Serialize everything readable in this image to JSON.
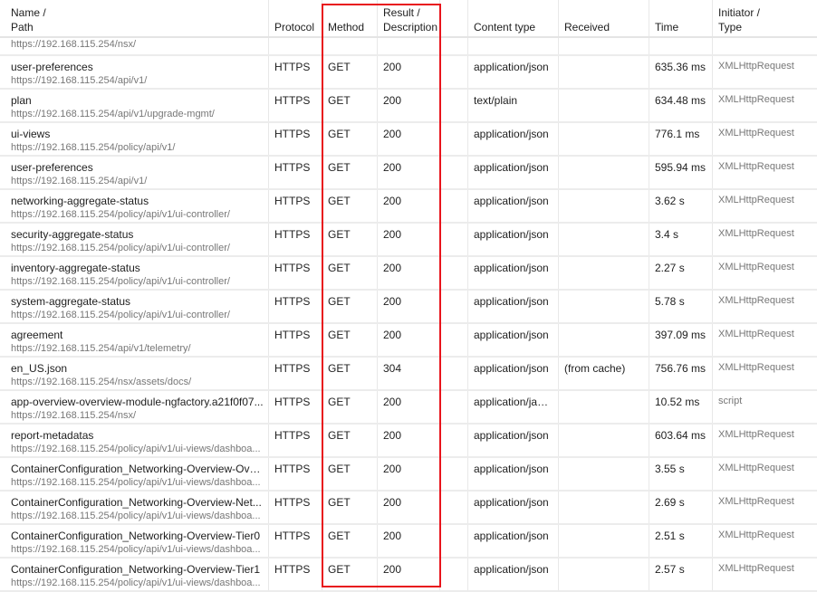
{
  "header": {
    "name": "Name /",
    "path": "Path",
    "protocol": "Protocol",
    "method": "Method",
    "result": "Result /",
    "description": "Description",
    "content_type": "Content type",
    "received": "Received",
    "time": "Time",
    "initiator": "Initiator /",
    "type": "Type"
  },
  "partial_row": {
    "path": "https://192.168.115.254/nsx/"
  },
  "rows": [
    {
      "name": "user-preferences",
      "path": "https://192.168.115.254/api/v1/",
      "protocol": "HTTPS",
      "method": "GET",
      "result": "200",
      "content_type": "application/json",
      "received": "",
      "time": "635.36 ms",
      "initiator": "XMLHttpRequest"
    },
    {
      "name": "plan",
      "path": "https://192.168.115.254/api/v1/upgrade-mgmt/",
      "protocol": "HTTPS",
      "method": "GET",
      "result": "200",
      "content_type": "text/plain",
      "received": "",
      "time": "634.48 ms",
      "initiator": "XMLHttpRequest"
    },
    {
      "name": "ui-views",
      "path": "https://192.168.115.254/policy/api/v1/",
      "protocol": "HTTPS",
      "method": "GET",
      "result": "200",
      "content_type": "application/json",
      "received": "",
      "time": "776.1 ms",
      "initiator": "XMLHttpRequest"
    },
    {
      "name": "user-preferences",
      "path": "https://192.168.115.254/api/v1/",
      "protocol": "HTTPS",
      "method": "GET",
      "result": "200",
      "content_type": "application/json",
      "received": "",
      "time": "595.94 ms",
      "initiator": "XMLHttpRequest"
    },
    {
      "name": "networking-aggregate-status",
      "path": "https://192.168.115.254/policy/api/v1/ui-controller/",
      "protocol": "HTTPS",
      "method": "GET",
      "result": "200",
      "content_type": "application/json",
      "received": "",
      "time": "3.62 s",
      "initiator": "XMLHttpRequest"
    },
    {
      "name": "security-aggregate-status",
      "path": "https://192.168.115.254/policy/api/v1/ui-controller/",
      "protocol": "HTTPS",
      "method": "GET",
      "result": "200",
      "content_type": "application/json",
      "received": "",
      "time": "3.4 s",
      "initiator": "XMLHttpRequest"
    },
    {
      "name": "inventory-aggregate-status",
      "path": "https://192.168.115.254/policy/api/v1/ui-controller/",
      "protocol": "HTTPS",
      "method": "GET",
      "result": "200",
      "content_type": "application/json",
      "received": "",
      "time": "2.27 s",
      "initiator": "XMLHttpRequest"
    },
    {
      "name": "system-aggregate-status",
      "path": "https://192.168.115.254/policy/api/v1/ui-controller/",
      "protocol": "HTTPS",
      "method": "GET",
      "result": "200",
      "content_type": "application/json",
      "received": "",
      "time": "5.78 s",
      "initiator": "XMLHttpRequest"
    },
    {
      "name": "agreement",
      "path": "https://192.168.115.254/api/v1/telemetry/",
      "protocol": "HTTPS",
      "method": "GET",
      "result": "200",
      "content_type": "application/json",
      "received": "",
      "time": "397.09 ms",
      "initiator": "XMLHttpRequest"
    },
    {
      "name": "en_US.json",
      "path": "https://192.168.115.254/nsx/assets/docs/",
      "protocol": "HTTPS",
      "method": "GET",
      "result": "304",
      "content_type": "application/json",
      "received": "(from cache)",
      "time": "756.76 ms",
      "initiator": "XMLHttpRequest"
    },
    {
      "name": "app-overview-overview-module-ngfactory.a21f0f07...",
      "path": "https://192.168.115.254/nsx/",
      "protocol": "HTTPS",
      "method": "GET",
      "result": "200",
      "content_type": "application/java...",
      "received": "",
      "time": "10.52 ms",
      "initiator": "script"
    },
    {
      "name": "report-metadatas",
      "path": "https://192.168.115.254/policy/api/v1/ui-views/dashboa...",
      "protocol": "HTTPS",
      "method": "GET",
      "result": "200",
      "content_type": "application/json",
      "received": "",
      "time": "603.64 ms",
      "initiator": "XMLHttpRequest"
    },
    {
      "name": "ContainerConfiguration_Networking-Overview-Ove...",
      "path": "https://192.168.115.254/policy/api/v1/ui-views/dashboa...",
      "protocol": "HTTPS",
      "method": "GET",
      "result": "200",
      "content_type": "application/json",
      "received": "",
      "time": "3.55 s",
      "initiator": "XMLHttpRequest"
    },
    {
      "name": "ContainerConfiguration_Networking-Overview-Net...",
      "path": "https://192.168.115.254/policy/api/v1/ui-views/dashboa...",
      "protocol": "HTTPS",
      "method": "GET",
      "result": "200",
      "content_type": "application/json",
      "received": "",
      "time": "2.69 s",
      "initiator": "XMLHttpRequest"
    },
    {
      "name": "ContainerConfiguration_Networking-Overview-Tier0",
      "path": "https://192.168.115.254/policy/api/v1/ui-views/dashboa...",
      "protocol": "HTTPS",
      "method": "GET",
      "result": "200",
      "content_type": "application/json",
      "received": "",
      "time": "2.51 s",
      "initiator": "XMLHttpRequest"
    },
    {
      "name": "ContainerConfiguration_Networking-Overview-Tier1",
      "path": "https://192.168.115.254/policy/api/v1/ui-views/dashboa...",
      "protocol": "HTTPS",
      "method": "GET",
      "result": "200",
      "content_type": "application/json",
      "received": "",
      "time": "2.57 s",
      "initiator": "XMLHttpRequest"
    }
  ],
  "colors": {
    "highlight": "#e8141c"
  }
}
